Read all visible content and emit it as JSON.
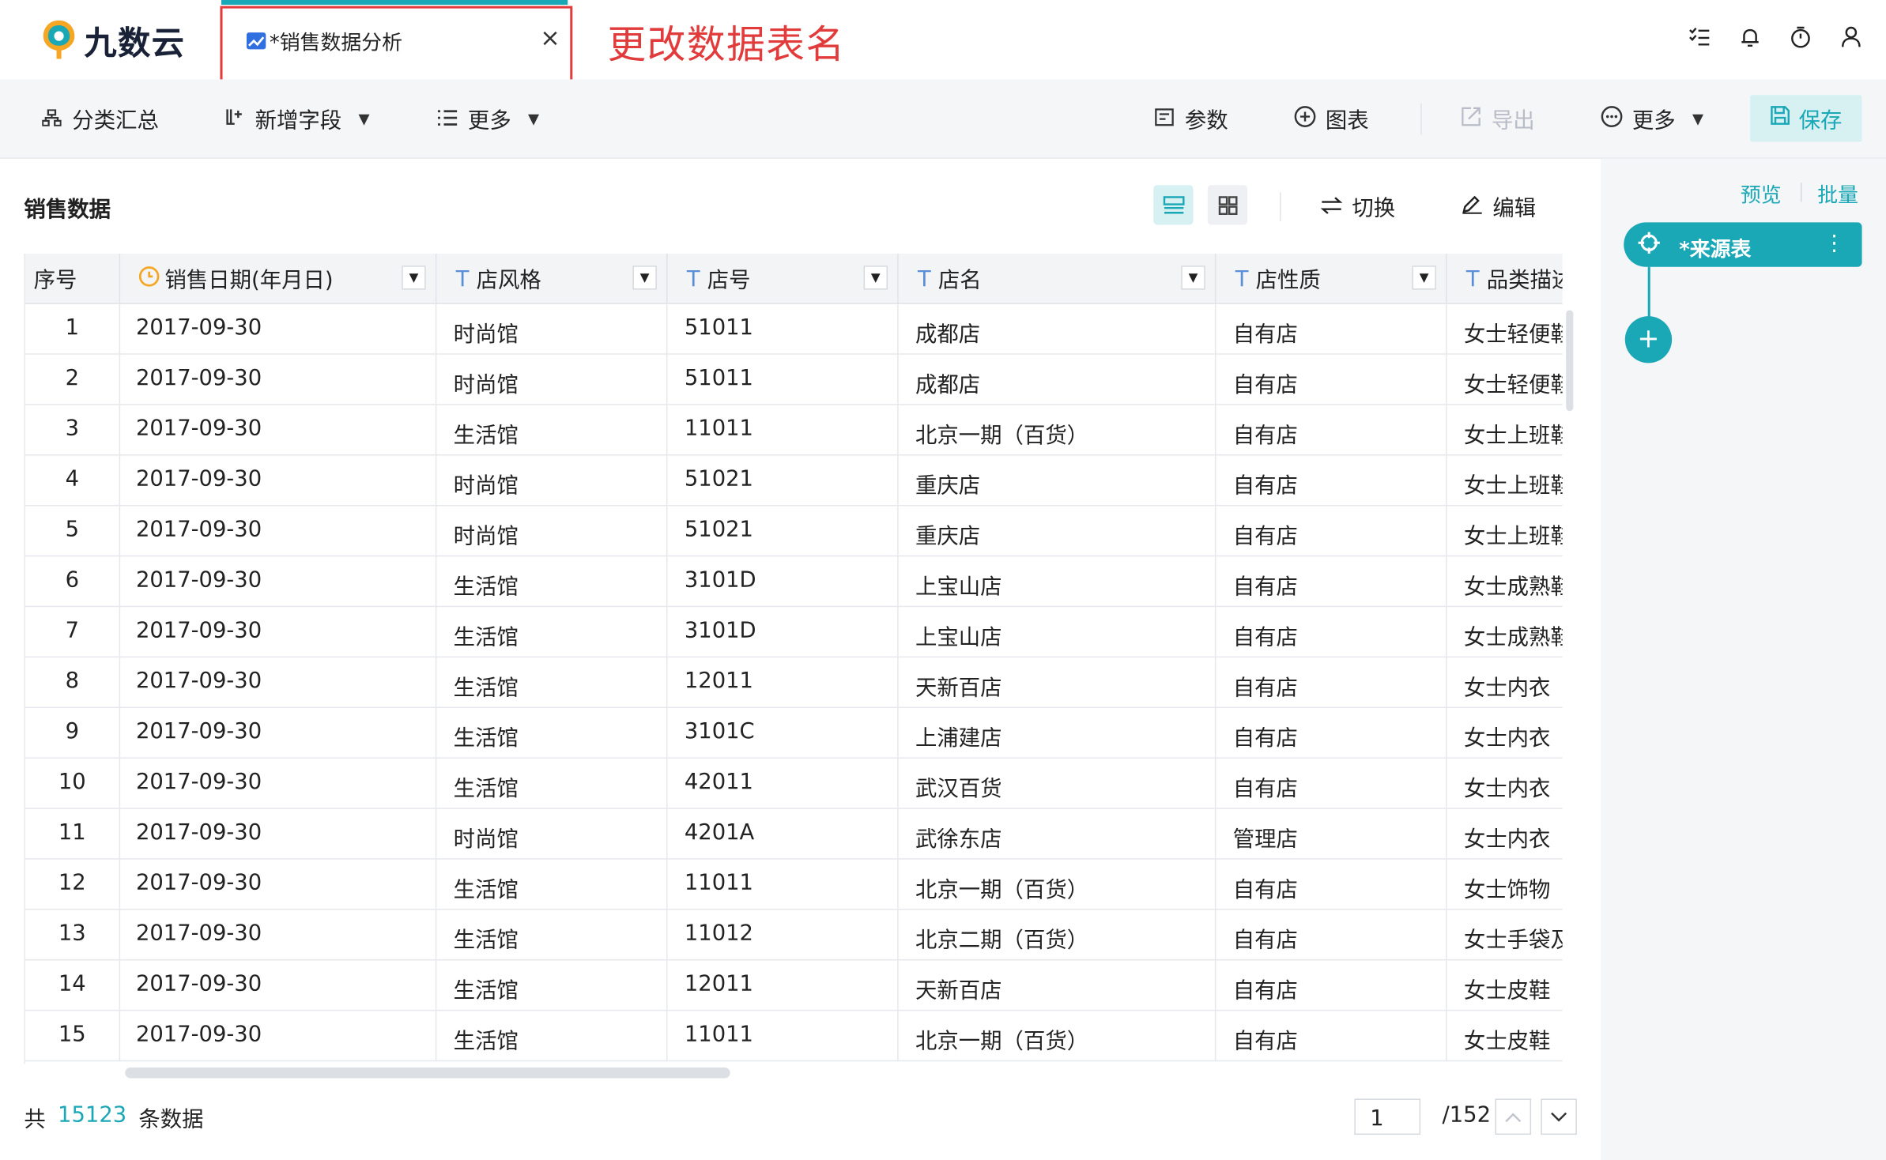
{
  "app": {
    "logo_text": "九数云",
    "tab_title": "*销售数据分析",
    "tab_close": "×",
    "annotation": "更改数据表名"
  },
  "top_icons": [
    "task-list-icon",
    "bell-icon",
    "timer-icon",
    "user-icon"
  ],
  "toolbar": {
    "group_summary": "分类汇总",
    "add_field": "新增字段",
    "more_left": "更多",
    "params": "参数",
    "chart": "图表",
    "export": "导出",
    "more_right": "更多",
    "save": "保存"
  },
  "right_panel": {
    "preview": "预览",
    "batch": "批量",
    "source_node": "*来源表"
  },
  "content": {
    "title": "销售数据",
    "switch": "切换",
    "edit": "编辑"
  },
  "table": {
    "columns": [
      {
        "label": "序号",
        "type": ""
      },
      {
        "label": "销售日期(年月日)",
        "type": "date"
      },
      {
        "label": "店风格",
        "type": "T"
      },
      {
        "label": "店号",
        "type": "T"
      },
      {
        "label": "店名",
        "type": "T"
      },
      {
        "label": "店性质",
        "type": "T"
      },
      {
        "label": "品类描述",
        "type": "T"
      }
    ],
    "rows": [
      [
        "1",
        "2017-09-30",
        "时尚馆",
        "51011",
        "成都店",
        "自有店",
        "女士轻便鞋"
      ],
      [
        "2",
        "2017-09-30",
        "时尚馆",
        "51011",
        "成都店",
        "自有店",
        "女士轻便鞋"
      ],
      [
        "3",
        "2017-09-30",
        "生活馆",
        "11011",
        "北京一期（百货）",
        "自有店",
        "女士上班鞋"
      ],
      [
        "4",
        "2017-09-30",
        "时尚馆",
        "51021",
        "重庆店",
        "自有店",
        "女士上班鞋"
      ],
      [
        "5",
        "2017-09-30",
        "时尚馆",
        "51021",
        "重庆店",
        "自有店",
        "女士上班鞋"
      ],
      [
        "6",
        "2017-09-30",
        "生活馆",
        "3101D",
        "上宝山店",
        "自有店",
        "女士成熟鞋"
      ],
      [
        "7",
        "2017-09-30",
        "生活馆",
        "3101D",
        "上宝山店",
        "自有店",
        "女士成熟鞋"
      ],
      [
        "8",
        "2017-09-30",
        "生活馆",
        "12011",
        "天新百店",
        "自有店",
        "女士内衣"
      ],
      [
        "9",
        "2017-09-30",
        "生活馆",
        "3101C",
        "上浦建店",
        "自有店",
        "女士内衣"
      ],
      [
        "10",
        "2017-09-30",
        "生活馆",
        "42011",
        "武汉百货",
        "自有店",
        "女士内衣"
      ],
      [
        "11",
        "2017-09-30",
        "时尚馆",
        "4201A",
        "武徐东店",
        "管理店",
        "女士内衣"
      ],
      [
        "12",
        "2017-09-30",
        "生活馆",
        "11011",
        "北京一期（百货）",
        "自有店",
        "女士饰物"
      ],
      [
        "13",
        "2017-09-30",
        "生活馆",
        "11012",
        "北京二期（百货）",
        "自有店",
        "女士手袋及"
      ],
      [
        "14",
        "2017-09-30",
        "生活馆",
        "12011",
        "天新百店",
        "自有店",
        "女士皮鞋"
      ],
      [
        "15",
        "2017-09-30",
        "生活馆",
        "11011",
        "北京一期（百货）",
        "自有店",
        "女士皮鞋"
      ]
    ]
  },
  "footer": {
    "prefix": "共",
    "count": "15123",
    "suffix": "条数据",
    "page": "1",
    "total": "/152"
  },
  "colors": {
    "accent": "#1aa7b6",
    "annotation_red": "#e23b3b",
    "type_blue": "#5a8fd8",
    "date_orange": "#f5a623"
  }
}
